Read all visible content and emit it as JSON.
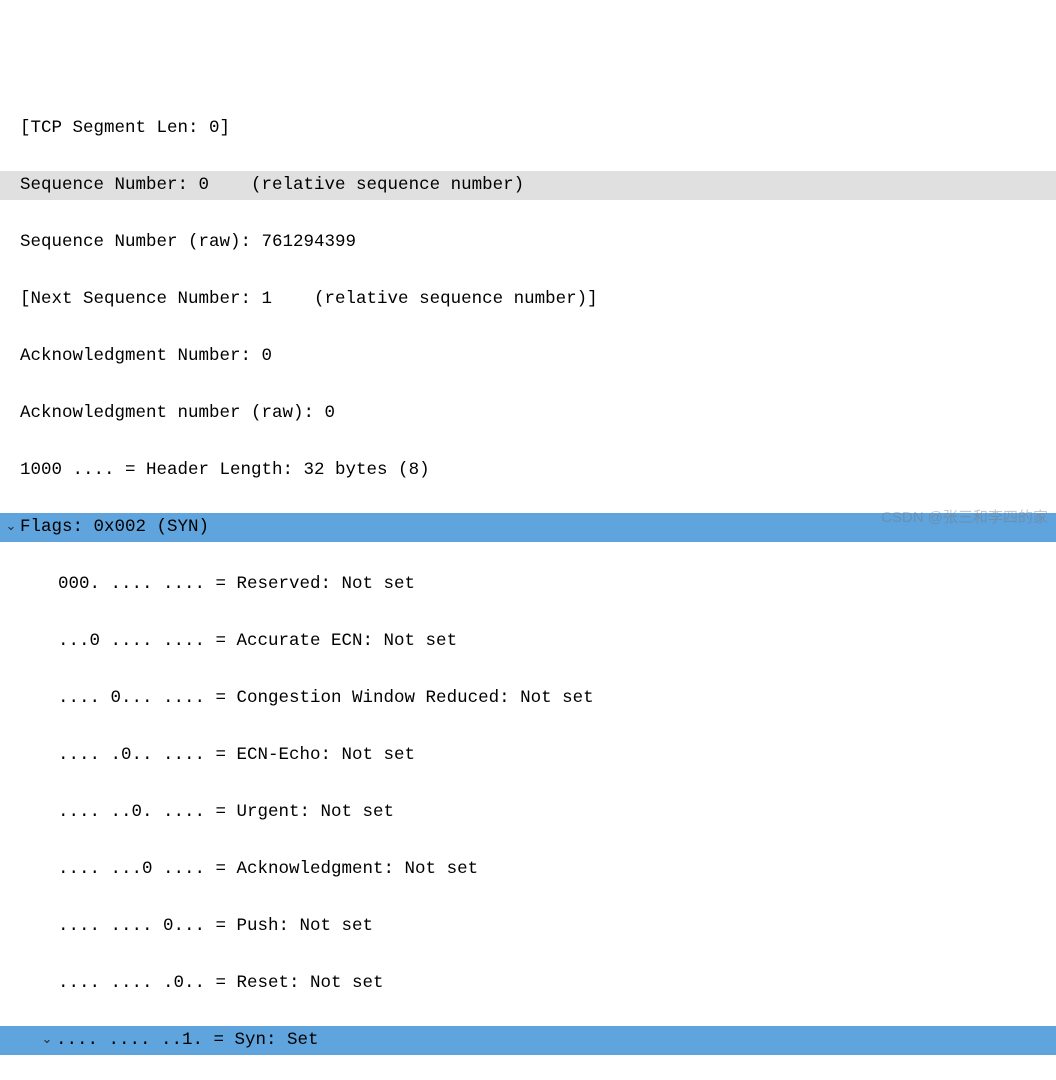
{
  "lines": {
    "tcp_segment_len": "[TCP Segment Len: 0]",
    "seq_num_rel": "Sequence Number: 0    (relative sequence number)",
    "seq_num_raw": "Sequence Number (raw): 761294399",
    "next_seq": "[Next Sequence Number: 1    (relative sequence number)]",
    "ack_num": "Acknowledgment Number: 0",
    "ack_num_raw": "Acknowledgment number (raw): 0",
    "header_len": "1000 .... = Header Length: 32 bytes (8)",
    "flags": "Flags: 0x002 (SYN)",
    "reserved": "000. .... .... = Reserved: Not set",
    "acc_ecn": "...0 .... .... = Accurate ECN: Not set",
    "cwr": ".... 0... .... = Congestion Window Reduced: Not set",
    "ecn_echo": ".... .0.. .... = ECN-Echo: Not set",
    "urgent": ".... ..0. .... = Urgent: Not set",
    "ack_flag": ".... ...0 .... = Acknowledgment: Not set",
    "push": ".... .... 0... = Push: Not set",
    "reset": ".... .... .0.. = Reset: Not set",
    "syn": ".... .... ..1. = Syn: Set"
  },
  "carets": {
    "open": "⌄",
    "open_small": "⌄"
  },
  "watermark": "CSDN @张三和李四的家"
}
